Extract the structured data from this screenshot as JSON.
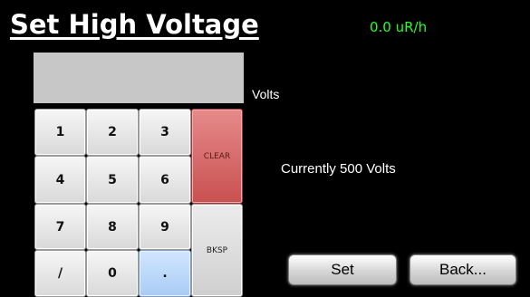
{
  "header": {
    "title": "Set High Voltage",
    "reading": "0.0 uR/h"
  },
  "entry": {
    "display_value": "",
    "units_label": "Volts"
  },
  "status": {
    "current_text": "Currently 500 Volts"
  },
  "keypad": {
    "k1": "1",
    "k2": "2",
    "k3": "3",
    "k4": "4",
    "k5": "5",
    "k6": "6",
    "k7": "7",
    "k8": "8",
    "k9": "9",
    "slash": "/",
    "k0": "0",
    "dot": ".",
    "clear": "CLEAR",
    "bksp": "BKSP"
  },
  "actions": {
    "set_label": "Set",
    "back_label": "Back..."
  },
  "colors": {
    "background": "#000000",
    "reading": "#22ff22",
    "clear_key": "#c95050",
    "dot_key": "#a9ccf5",
    "display": "#c7c7c7"
  }
}
